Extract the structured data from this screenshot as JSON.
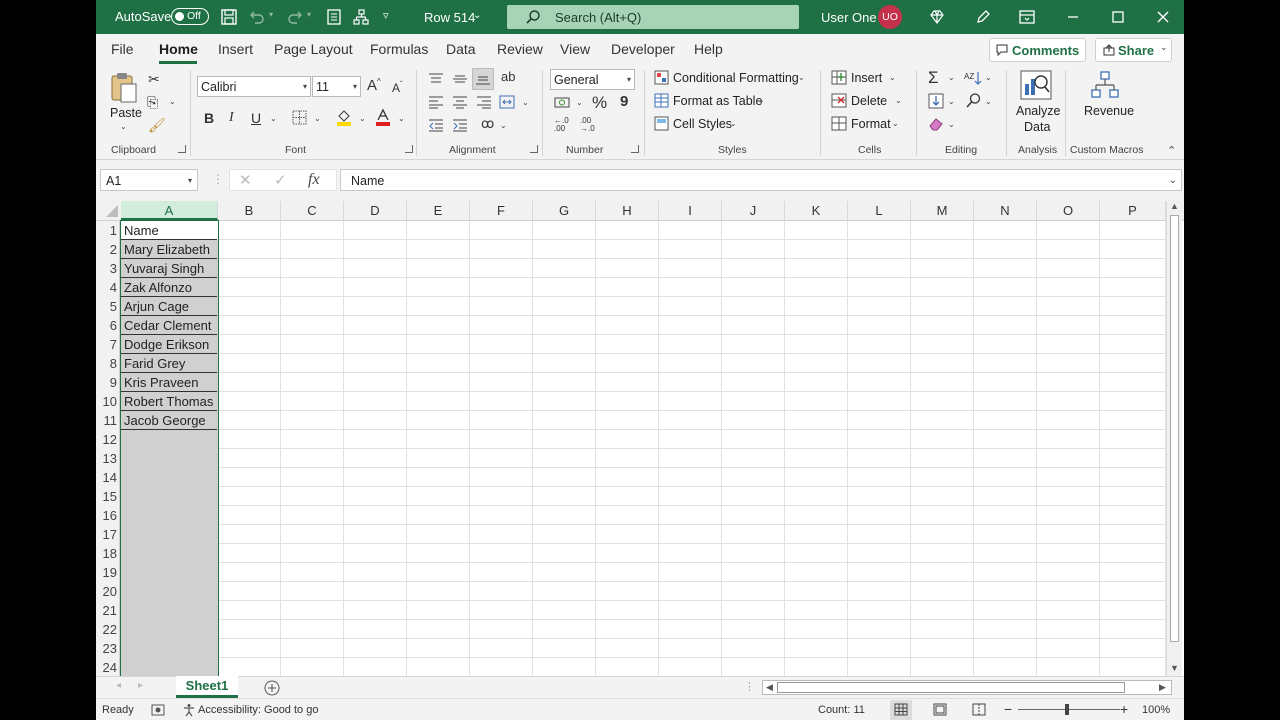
{
  "titlebar": {
    "autosave_label": "AutoSave",
    "autosave_state": "Off",
    "doc_title": "Row 514",
    "search_placeholder": "Search (Alt+Q)",
    "user_name": "User One",
    "user_initials": "UO"
  },
  "menu": {
    "tabs": [
      "File",
      "Home",
      "Insert",
      "Page Layout",
      "Formulas",
      "Data",
      "Review",
      "View",
      "Developer",
      "Help"
    ],
    "active_tab": "Home",
    "comments_label": "Comments",
    "share_label": "Share"
  },
  "ribbon": {
    "clipboard": {
      "paste": "Paste",
      "group": "Clipboard"
    },
    "font": {
      "name": "Calibri",
      "size": "11",
      "group": "Font",
      "bold": "B",
      "italic": "I",
      "underline": "U"
    },
    "alignment": {
      "group": "Alignment"
    },
    "number": {
      "format": "General",
      "group": "Number",
      "percent": "%",
      "comma": "9",
      "inc_decimal": "←.0\n.00",
      "dec_decimal": ".00\n→.0"
    },
    "styles": {
      "conditional": "Conditional Formatting",
      "format_table": "Format as Table",
      "cell_styles": "Cell Styles",
      "group": "Styles"
    },
    "cells": {
      "insert": "Insert",
      "delete": "Delete",
      "format": "Format",
      "group": "Cells"
    },
    "editing": {
      "group": "Editing"
    },
    "analysis": {
      "analyze_line1": "Analyze",
      "analyze_line2": "Data",
      "group": "Analysis"
    },
    "custom": {
      "revenue": "Revenue",
      "group": "Custom Macros"
    }
  },
  "formula_bar": {
    "name_box": "A1",
    "fx": "fx",
    "value": "Name"
  },
  "grid": {
    "columns": [
      "A",
      "B",
      "C",
      "D",
      "E",
      "F",
      "G",
      "H",
      "I",
      "J",
      "K",
      "L",
      "M",
      "N",
      "O",
      "P"
    ],
    "rows": [
      "1",
      "2",
      "3",
      "4",
      "5",
      "6",
      "7",
      "8",
      "9",
      "10",
      "11",
      "12",
      "13",
      "14",
      "15",
      "16",
      "17",
      "18",
      "19",
      "20",
      "21",
      "22",
      "23",
      "24"
    ],
    "column_a": [
      "Name",
      "Mary Elizabeth",
      "Yuvaraj Singh",
      "Zak Alfonzo",
      "Arjun Cage",
      "Cedar Clement",
      "Dodge Erikson",
      "Farid Grey",
      "Kris Praveen",
      "Robert Thomas",
      "Jacob George"
    ]
  },
  "sheets": {
    "active": "Sheet1"
  },
  "status": {
    "ready": "Ready",
    "accessibility": "Accessibility: Good to go",
    "count": "Count: 11",
    "zoom": "100%"
  },
  "colors": {
    "accent": "#1f7145",
    "selection": "#d3eddc",
    "selected_cells": "#d0d0d0",
    "avatar": "#c4314b"
  }
}
